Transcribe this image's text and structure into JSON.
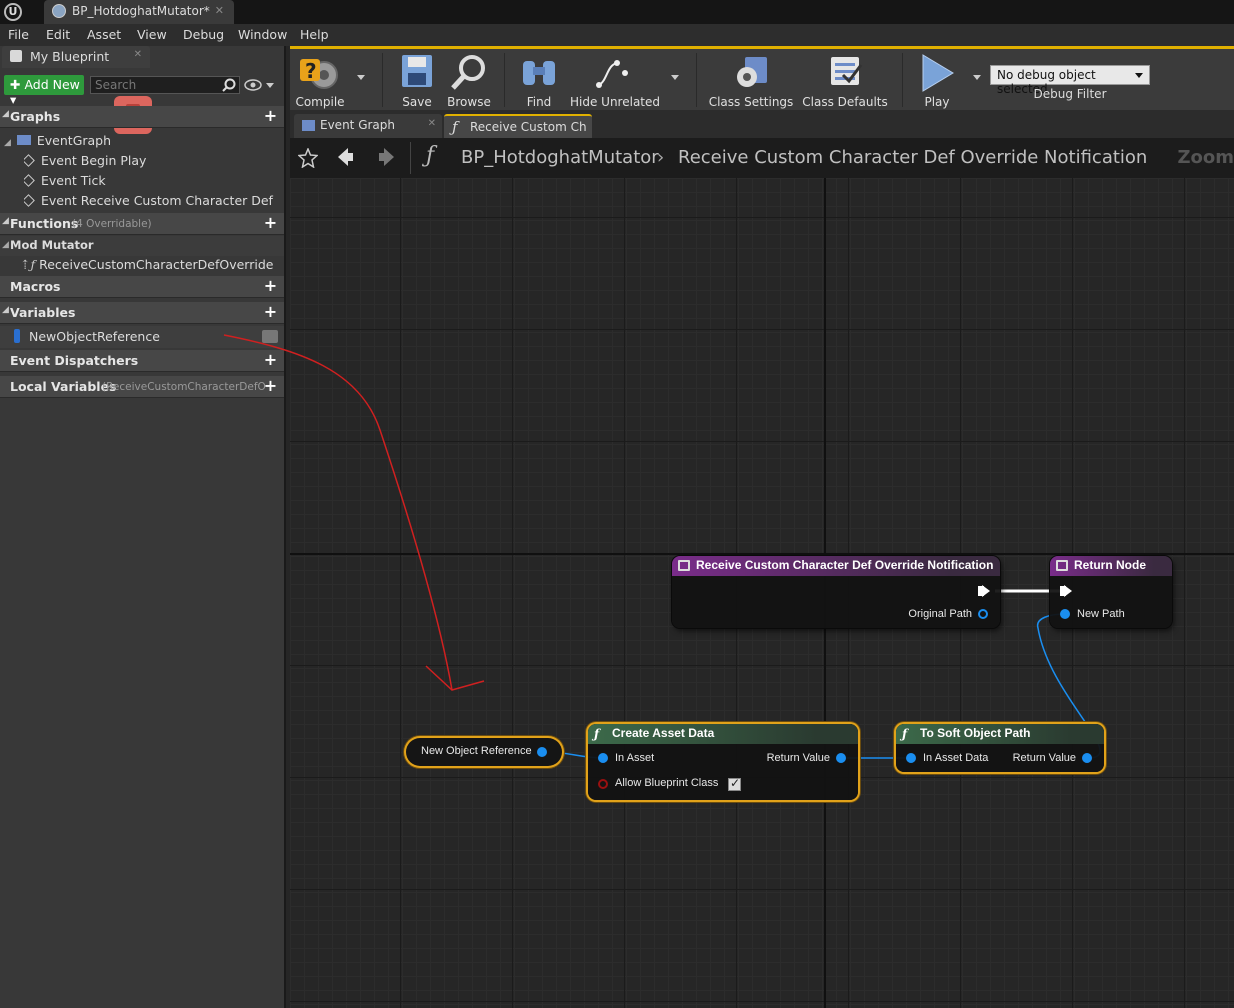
{
  "window": {
    "doc_tab": "BP_HotdoghatMutator*"
  },
  "menu": [
    "File",
    "Edit",
    "Asset",
    "View",
    "Debug",
    "Window",
    "Help"
  ],
  "left_panel": {
    "tab": "My Blueprint",
    "add_new": "Add New",
    "search_placeholder": "Search",
    "graphs": {
      "title": "Graphs",
      "eventgraph": "EventGraph",
      "events": [
        "Event Begin Play",
        "Event Tick",
        "Event Receive Custom Character Def Mod"
      ]
    },
    "functions": {
      "title": "Functions",
      "sub": "(4 Overridable)"
    },
    "mod_mutator": {
      "title": "Mod Mutator",
      "item": "ReceiveCustomCharacterDefOverrideNo"
    },
    "macros": "Macros",
    "variables": {
      "title": "Variables",
      "item": "NewObjectReference"
    },
    "event_dispatchers": "Event Dispatchers",
    "local_variables": {
      "title": "Local Variables",
      "sub": "(ReceiveCustomCharacterDefO"
    }
  },
  "toolbar": {
    "compile": "Compile",
    "save": "Save",
    "browse": "Browse",
    "find": "Find",
    "hide_unrelated": "Hide Unrelated",
    "class_settings": "Class Settings",
    "class_defaults": "Class Defaults",
    "play": "Play",
    "debug_select": "No debug object selected",
    "debug_filter": "Debug Filter"
  },
  "graph_tabs": [
    "Event Graph",
    "Receive Custom Ch"
  ],
  "breadcrumb": {
    "blueprint": "BP_HotdoghatMutator",
    "function": "Receive Custom Character Def Override Notification",
    "zoom": "Zoom"
  },
  "nodes": {
    "entry": {
      "title": "Receive Custom Character Def Override Notification",
      "pin_out": "Original Path"
    },
    "return": {
      "title": "Return Node",
      "pin_in": "New Path"
    },
    "variable": {
      "title": "New Object Reference"
    },
    "create_asset": {
      "title": "Create Asset Data",
      "pin_in": "In Asset",
      "pin_out": "Return Value",
      "pin_bool": "Allow Blueprint Class",
      "bool_value": "true"
    },
    "to_soft": {
      "title": "To Soft Object Path",
      "pin_in": "In Asset Data",
      "pin_out": "Return Value"
    }
  },
  "colors": {
    "accent": "#e0b000",
    "pin": "#1a8ef0",
    "entry_header": "#7a2c8a",
    "func_header": "#3c6a4a",
    "annotation": "#d02020"
  }
}
